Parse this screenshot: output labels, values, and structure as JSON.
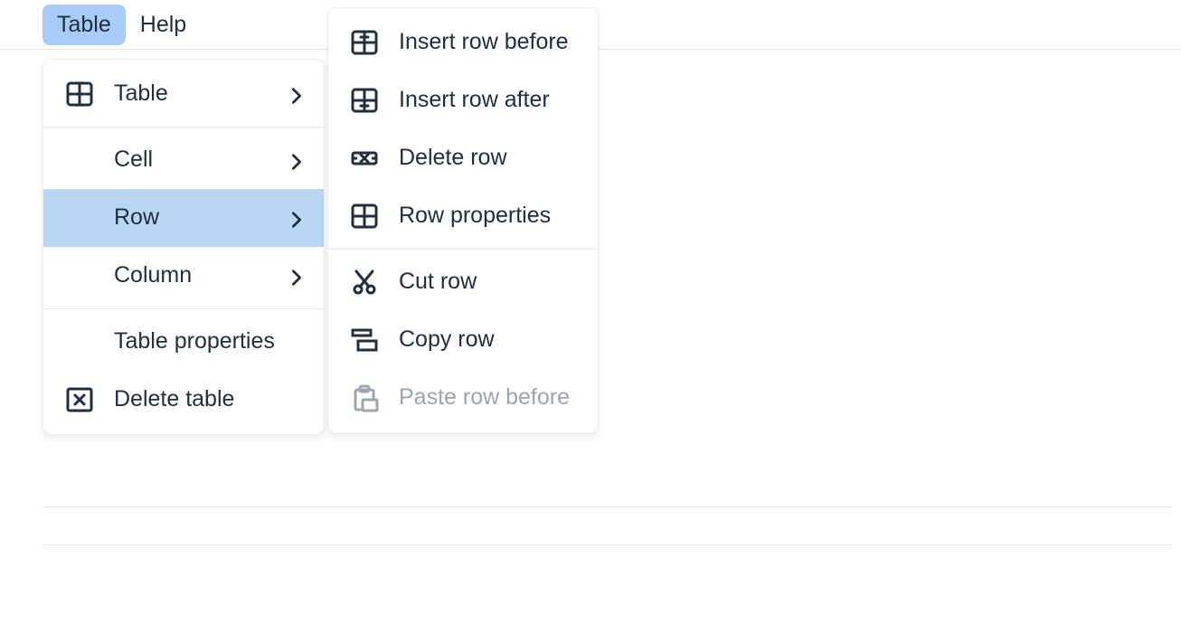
{
  "menubar": {
    "table": "Table",
    "help": "Help"
  },
  "menu1": {
    "table": "Table",
    "cell": "Cell",
    "row": "Row",
    "column": "Column",
    "table_properties": "Table properties",
    "delete_table": "Delete table"
  },
  "menu2": {
    "insert_before": "Insert row before",
    "insert_after": "Insert row after",
    "delete_row": "Delete row",
    "row_properties": "Row properties",
    "cut_row": "Cut row",
    "copy_row": "Copy row",
    "paste_before": "Paste row before"
  }
}
